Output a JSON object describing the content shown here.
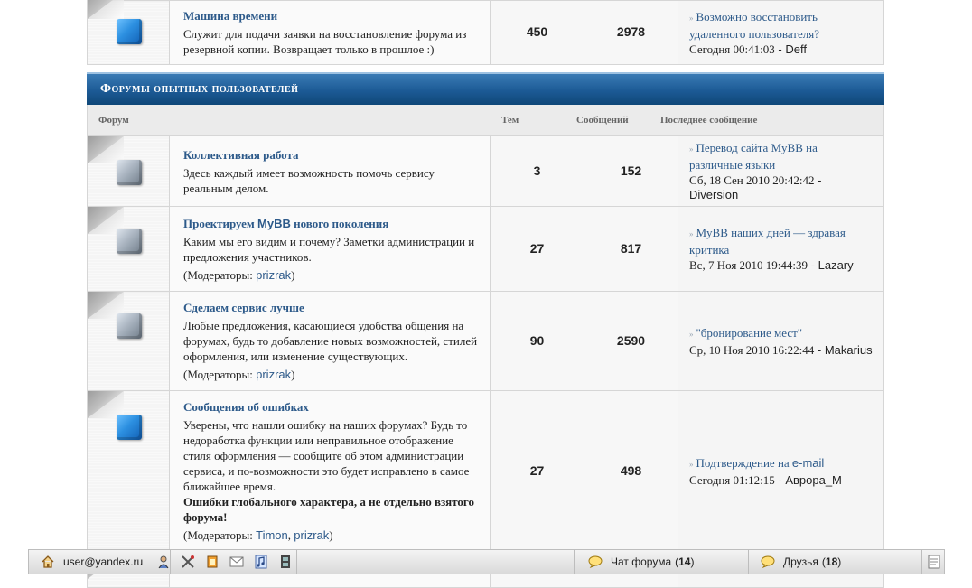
{
  "top_forum": {
    "title": "Машина времени",
    "desc": "Служит для подачи заявки на восстановление форума из резервной копии. Возвращает только в прошлое :)",
    "topics": "450",
    "posts": "2978",
    "last_title": "Возможно восстановить удаленного пользователя?",
    "last_date": "Сегодня 00:41:03",
    "last_author": "Deff"
  },
  "category": {
    "title": "Форумы опытных пользователей",
    "col_forum": "Форум",
    "col_topics": "Тем",
    "col_posts": "Сообщений",
    "col_last": "Последнее сообщение"
  },
  "forums": [
    {
      "title": "Коллективная работа",
      "desc": "Здесь каждый имеет возможность помочь сервису реальным делом.",
      "topics": "3",
      "posts": "152",
      "last_title": "Перевод сайта MyBB на различные языки",
      "last_date": "Сб, 18 Сен 2010 20:42:42",
      "last_author": "Diversion"
    },
    {
      "title_pre": "Проектируем ",
      "title_brand": "MyBB",
      "title_post": " нового поколения",
      "desc": "Каким мы его видим и почему? Заметки администрации и предложения участников.",
      "mods_label": "(Модераторы:",
      "mod1": "prizrak",
      "mods_close": ")",
      "topics": "27",
      "posts": "817",
      "last_title": "MyBB наших дней — здравая критика",
      "last_date": "Вс, 7 Ноя 2010 19:44:39",
      "last_author": "Lazary"
    },
    {
      "title": "Сделаем сервис лучше",
      "desc": "Любые предложения, касающиеся удобства общения на форумах, будь то добавление новых возможностей, стилей оформления, или изменение существующих.",
      "mods_label": "(Модераторы:",
      "mod1": "prizrak",
      "mods_close": ")",
      "topics": "90",
      "posts": "2590",
      "last_title": "\"бронирование мест\"",
      "last_date": "Ср, 10 Ноя 2010 16:22:44",
      "last_author": "Makarius"
    },
    {
      "title": "Сообщения об ошибках",
      "desc": "Уверены, что нашли ошибку на наших форумах? Будь то недоработка функции или неправильное отображение стиля оформления — сообщите об этом администрации сервиса, и по-возможности это будет исправлено в самое ближайшее время.",
      "desc_bold": "Ошибки глобального характера, а не отдельно взятого форума!",
      "mods_label": "(Модераторы:",
      "mod1": "Timon",
      "mods_sep": ",",
      "mod2": "prizrak",
      "mods_close": ")",
      "topics": "27",
      "posts": "498",
      "last_title_pre": "Подтверждение на ",
      "last_title_brand": "e-mail",
      "last_date": "Сегодня 01:12:15",
      "last_author": "Аврора_М"
    }
  ],
  "taskbar": {
    "user": "user@yandex.ru",
    "chat_label": "Чат форума",
    "chat_count": "14",
    "friends_label": "Друзья",
    "friends_count": "18",
    "icons": [
      "home-icon",
      "profile-icon",
      "tools-icon",
      "notes-icon",
      "mail-icon",
      "music-icon",
      "film-icon",
      "page-icon"
    ]
  },
  "separator": " - ",
  "colors": {
    "header_blue": "#1c5a95",
    "link_blue": "#2d5a8a",
    "cube_new": "#2c8fe0",
    "cube_old": "#a9b4c0"
  }
}
